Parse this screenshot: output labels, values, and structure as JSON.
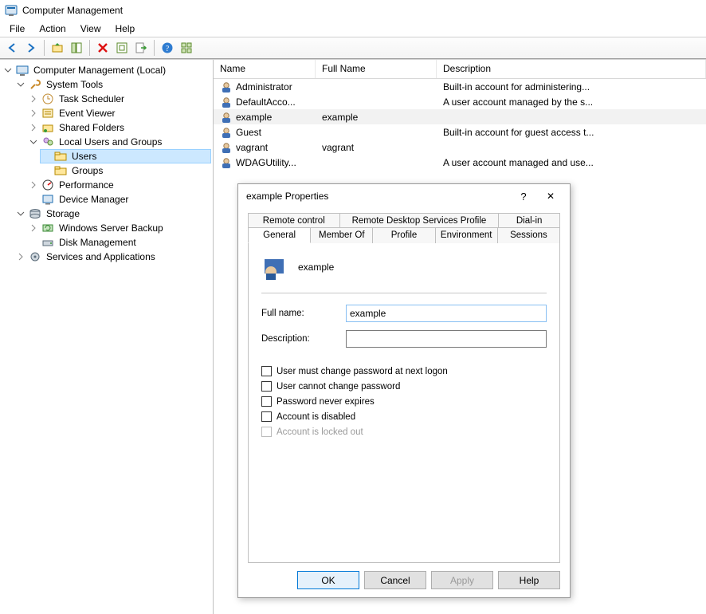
{
  "window": {
    "title": "Computer Management"
  },
  "menu": {
    "file": "File",
    "action": "Action",
    "view": "View",
    "help": "Help"
  },
  "toolbar": {
    "back": "Back",
    "forward": "Forward",
    "up": "Up",
    "show": "Show/Hide",
    "delete": "Delete",
    "refresh": "Refresh",
    "export": "Export",
    "help": "Help",
    "extra": "Tile"
  },
  "tree": {
    "root": "Computer Management (Local)",
    "system_tools": "System Tools",
    "task_scheduler": "Task Scheduler",
    "event_viewer": "Event Viewer",
    "shared_folders": "Shared Folders",
    "local_users_groups": "Local Users and Groups",
    "users": "Users",
    "groups": "Groups",
    "performance": "Performance",
    "device_manager": "Device Manager",
    "storage": "Storage",
    "wsb": "Windows Server Backup",
    "disk_mgmt": "Disk Management",
    "services_apps": "Services and Applications"
  },
  "list": {
    "cols": {
      "name": "Name",
      "full": "Full Name",
      "desc": "Description"
    },
    "rows": [
      {
        "name": "Administrator",
        "full": "",
        "desc": "Built-in account for administering..."
      },
      {
        "name": "DefaultAcco...",
        "full": "",
        "desc": "A user account managed by the s..."
      },
      {
        "name": "example",
        "full": "example",
        "desc": "",
        "selected": true
      },
      {
        "name": "Guest",
        "full": "",
        "desc": "Built-in account for guest access t..."
      },
      {
        "name": "vagrant",
        "full": "vagrant",
        "desc": ""
      },
      {
        "name": "WDAGUtility...",
        "full": "",
        "desc": "A user account managed and use..."
      }
    ]
  },
  "dialog": {
    "title": "example Properties",
    "help_glyph": "?",
    "close_glyph": "✕",
    "tabs_row1": {
      "rc": "Remote control",
      "rdsp": "Remote Desktop Services Profile",
      "dial": "Dial-in"
    },
    "tabs_row2": {
      "general": "General",
      "member": "Member Of",
      "profile": "Profile",
      "env": "Environment",
      "sess": "Sessions"
    },
    "username": "example",
    "full_name_label": "Full name:",
    "full_name_value": "example",
    "description_label": "Description:",
    "description_value": "",
    "chk1": "User must change password at next logon",
    "chk2": "User cannot change password",
    "chk3": "Password never expires",
    "chk4": "Account is disabled",
    "chk5": "Account is locked out",
    "ok": "OK",
    "cancel": "Cancel",
    "apply": "Apply",
    "help": "Help"
  }
}
